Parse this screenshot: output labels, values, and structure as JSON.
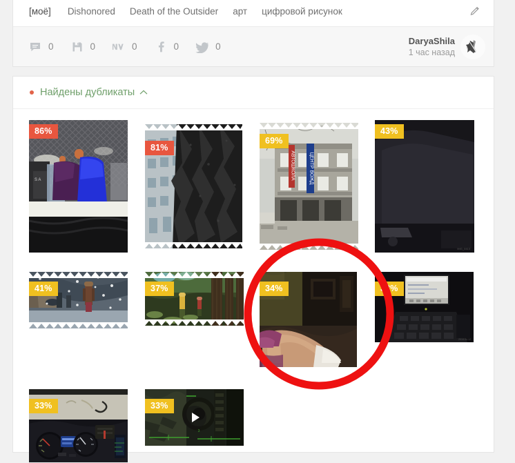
{
  "post": {
    "tags": [
      {
        "label": "[моё]",
        "own": true
      },
      {
        "label": "Dishonored",
        "own": false
      },
      {
        "label": "Death of the Outsider",
        "own": false
      },
      {
        "label": "арт",
        "own": false
      },
      {
        "label": "цифровой рисунок",
        "own": false
      }
    ],
    "edit_icon": "pencil-icon",
    "stats": [
      {
        "icon": "comment-icon",
        "count": "0",
        "name": "comments"
      },
      {
        "icon": "save-icon",
        "count": "0",
        "name": "saves"
      },
      {
        "icon": "vk-icon",
        "count": "0",
        "name": "vk-share"
      },
      {
        "icon": "facebook-icon",
        "count": "0",
        "name": "facebook-share"
      },
      {
        "icon": "twitter-icon",
        "count": "0",
        "name": "twitter-share"
      }
    ],
    "author": {
      "name": "DaryaShila",
      "time": "1 час назад",
      "avatar_icon": "avatar-image"
    }
  },
  "duplicates": {
    "title": "Найдены дубликаты",
    "collapse_chevron": "chevron-up-icon",
    "bullet_color": "#e2644a",
    "title_color": "#6f9f6a",
    "badge_colors": {
      "high": "#e8563f",
      "low": "#f0c020"
    },
    "items": [
      {
        "percent": "86%",
        "badge": "high",
        "kind": "image",
        "name": "duplicate-thumb-86"
      },
      {
        "percent": "81%",
        "badge": "high",
        "kind": "image",
        "name": "duplicate-thumb-81"
      },
      {
        "percent": "69%",
        "badge": "low",
        "kind": "image",
        "name": "duplicate-thumb-69"
      },
      {
        "percent": "43%",
        "badge": "low",
        "kind": "image",
        "name": "duplicate-thumb-43"
      },
      {
        "percent": "41%",
        "badge": "low",
        "kind": "image",
        "name": "duplicate-thumb-41"
      },
      {
        "percent": "37%",
        "badge": "low",
        "kind": "image",
        "name": "duplicate-thumb-37"
      },
      {
        "percent": "34%",
        "badge": "low",
        "kind": "image",
        "name": "duplicate-thumb-34"
      },
      {
        "percent": "33%",
        "badge": "low",
        "kind": "image",
        "name": "duplicate-thumb-33-a"
      },
      {
        "percent": "33%",
        "badge": "low",
        "kind": "image",
        "name": "duplicate-thumb-33-b"
      },
      {
        "percent": "33%",
        "badge": "low",
        "kind": "video",
        "name": "duplicate-thumb-33-c"
      }
    ]
  },
  "annotation": {
    "shape": "ellipse-highlight",
    "color": "#ee1111",
    "target": "duplicate-thumb-34"
  }
}
